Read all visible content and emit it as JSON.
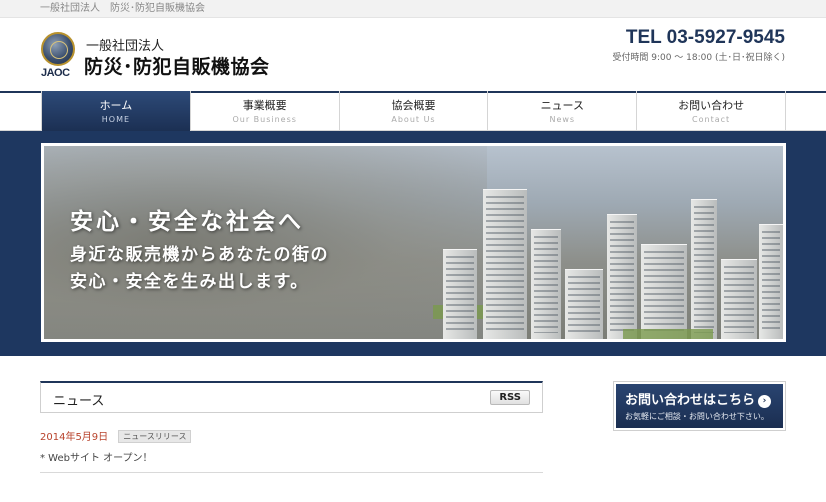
{
  "topbar": {
    "text": "一般社団法人　防災･防犯自販機協会"
  },
  "header": {
    "logo_text": "JAOC",
    "org_sub": "一般社団法人",
    "org_name": "防災･防犯自販機協会",
    "tel": "TEL 03-5927-9545",
    "hours": "受付時間 9:00 ～ 18:00 (土･日･祝日除く)"
  },
  "nav": {
    "items": [
      {
        "jp": "ホーム",
        "en": "HOME",
        "active": true
      },
      {
        "jp": "事業概要",
        "en": "Our Business"
      },
      {
        "jp": "協会概要",
        "en": "About Us"
      },
      {
        "jp": "ニュース",
        "en": "News"
      },
      {
        "jp": "お問い合わせ",
        "en": "Contact"
      }
    ]
  },
  "hero": {
    "title": "安心・安全な社会へ",
    "subtitle_line1": "身近な販売機からあなたの街の",
    "subtitle_line2": "安心・安全を生み出します。"
  },
  "news": {
    "title": "ニュース",
    "rss_label": "RSS",
    "entries": [
      {
        "date": "2014年5月9日",
        "category": "ニュースリリース",
        "text": "* Webサイト オープン！"
      }
    ]
  },
  "contact_banner": {
    "main": "お問い合わせはこちら",
    "arrow": "›",
    "sub": "お気軽にご相談・お問い合わせ下さい。"
  },
  "icons": {
    "logo": "emblem-icon",
    "contact_arrow": "arrow-right-circle-icon"
  },
  "colors": {
    "brand_navy": "#1f3559",
    "date_red": "#b8432c"
  }
}
